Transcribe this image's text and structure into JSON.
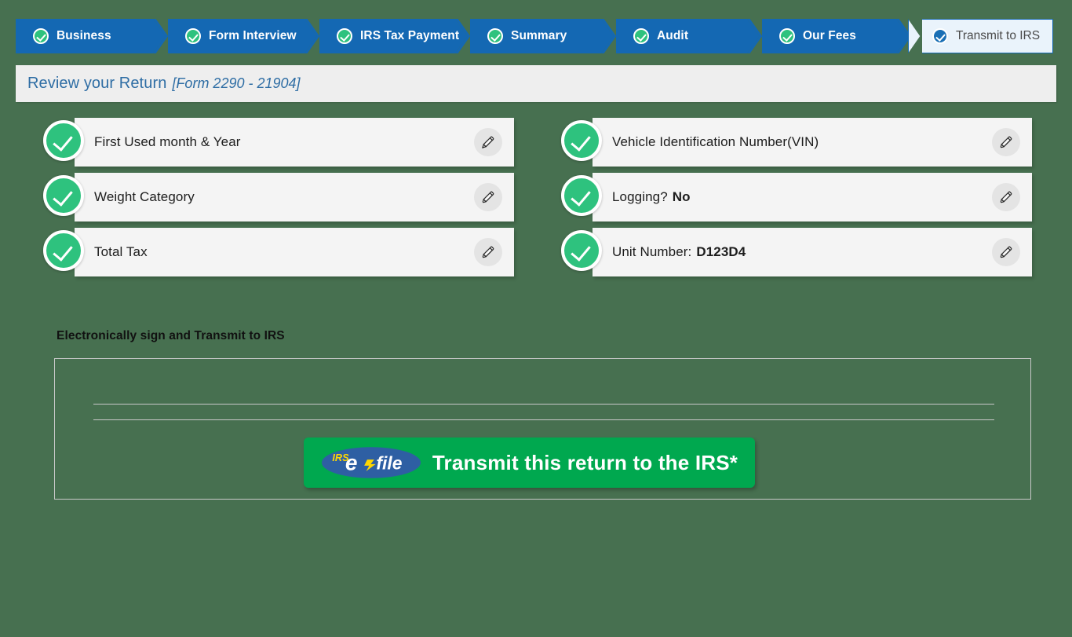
{
  "colors": {
    "page_background": "#477050",
    "step_blue": "#1468b3",
    "step_active_bg": "#eaf3fb",
    "check_green": "#2ec27e",
    "card_gray": "#f4f4f4",
    "title_blue": "#2e6da4",
    "transmit_green": "#00a84f",
    "efile_blue": "#2e5fa3",
    "efile_yellow": "#ffd700"
  },
  "steps": [
    {
      "label": "Business",
      "state": "complete"
    },
    {
      "label": "Form Interview",
      "state": "complete"
    },
    {
      "label": "IRS Tax Payment",
      "state": "complete"
    },
    {
      "label": "Summary",
      "state": "complete"
    },
    {
      "label": "Audit",
      "state": "complete"
    },
    {
      "label": "Our Fees",
      "state": "complete"
    },
    {
      "label": "Transmit to IRS",
      "state": "active"
    }
  ],
  "title": {
    "main": "Review your Return",
    "sub": "[Form 2290 - 21904]"
  },
  "review_cards": {
    "left": [
      {
        "label": "First Used month & Year",
        "value": "",
        "edit_icon": "pencil-icon",
        "status_icon": "check-circle-icon"
      },
      {
        "label": "Weight Category",
        "value": "",
        "edit_icon": "pencil-icon",
        "status_icon": "check-circle-icon"
      },
      {
        "label": "Total Tax",
        "value": "",
        "edit_icon": "pencil-icon",
        "status_icon": "check-circle-icon"
      }
    ],
    "right": [
      {
        "label": "Vehicle Identification Number(VIN)",
        "value": "",
        "edit_icon": "pencil-icon",
        "status_icon": "check-circle-icon"
      },
      {
        "label": "Logging?",
        "value": "No",
        "edit_icon": "pencil-icon",
        "status_icon": "check-circle-icon"
      },
      {
        "label": "Unit Number:",
        "value": "D123D4",
        "edit_icon": "pencil-icon",
        "status_icon": "check-circle-icon"
      }
    ]
  },
  "sign_section": {
    "heading": "Electronically sign and Transmit to IRS",
    "transmit_button": {
      "label": "Transmit this return to the IRS*",
      "logo_irs": "IRS",
      "logo_e": "e",
      "logo_file": "file",
      "logo_name": "irs-efile-logo"
    }
  }
}
